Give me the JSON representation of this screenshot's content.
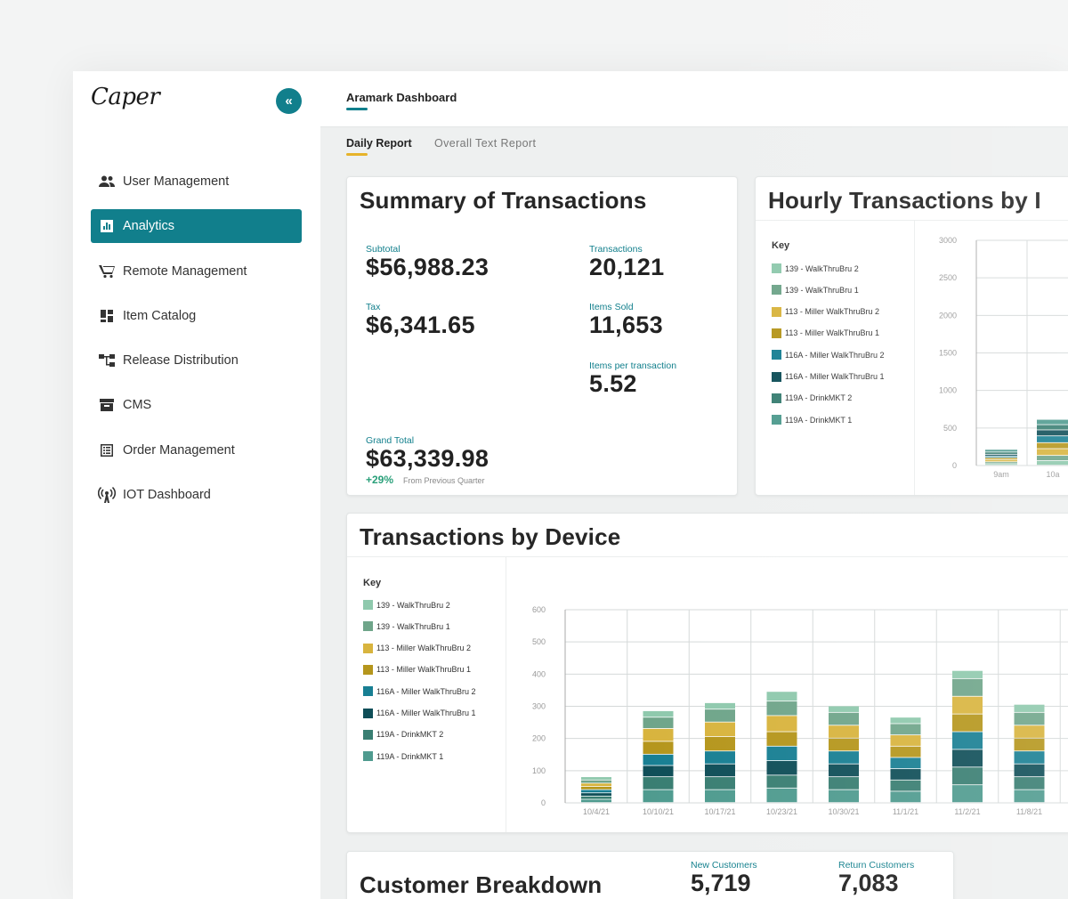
{
  "app": {
    "logo": "Caper",
    "collapse_icon": "«",
    "accent": "#117f8c"
  },
  "sidebar": {
    "items": [
      {
        "label": "User Management",
        "icon": "users-icon"
      },
      {
        "label": "Analytics",
        "icon": "bar-chart-icon",
        "active": true
      },
      {
        "label": "Remote Management",
        "icon": "cart-icon"
      },
      {
        "label": "Item Catalog",
        "icon": "grid-icon"
      },
      {
        "label": "Release Distribution",
        "icon": "tree-icon"
      },
      {
        "label": "CMS",
        "icon": "archive-icon"
      },
      {
        "label": "Order Management",
        "icon": "list-icon"
      },
      {
        "label": "IOT Dashboard",
        "icon": "broadcast-icon"
      }
    ]
  },
  "header": {
    "title": "Aramark Dashboard"
  },
  "tabs": [
    {
      "label": "Daily Report",
      "active": true
    },
    {
      "label": "Overall Text Report"
    }
  ],
  "summary": {
    "title": "Summary of Transactions",
    "subtotal_label": "Subtotal",
    "subtotal": "$56,988.23",
    "tax_label": "Tax",
    "tax": "$6,341.65",
    "transactions_label": "Transactions",
    "transactions": "20,121",
    "items_sold_label": "Items Sold",
    "items_sold": "11,653",
    "ipt_label": "Items per transaction",
    "ipt": "5.52",
    "grand_total_label": "Grand Total",
    "grand_total": "$63,339.98",
    "change": "+29%",
    "change_note": "From Previous Quarter"
  },
  "hourly": {
    "title": "Hourly Transactions by I",
    "key_title": "Key"
  },
  "device": {
    "title": "Transactions by Device",
    "key_title": "Key"
  },
  "legend": [
    {
      "label": "139 -  WalkThruBru 2",
      "color": "#8fc9ad"
    },
    {
      "label": "139 -  WalkThruBru 1",
      "color": "#6fa58a"
    },
    {
      "label": "113 - Miller WalkThruBru 2",
      "color": "#d8b43e"
    },
    {
      "label": "113 - Miller WalkThruBru 1",
      "color": "#b5961c"
    },
    {
      "label": "116A - Miller WalkThruBru 2",
      "color": "#187f93"
    },
    {
      "label": "116A - Miller WalkThruBru 1",
      "color": "#0f4e58"
    },
    {
      "label": "119A - DrinkMKT 2",
      "color": "#397e72"
    },
    {
      "label": "119A - DrinkMKT 1",
      "color": "#4f9b8f"
    }
  ],
  "customers": {
    "title": "Customer Breakdown",
    "new_label": "New Customers",
    "new_value": "5,719",
    "return_label": "Return Customers",
    "return_value": "7,083"
  },
  "chart_data": [
    {
      "type": "bar",
      "title": "Hourly Transactions by I",
      "stacked": true,
      "ylim": [
        0,
        3000
      ],
      "yticks": [
        "3000",
        "2500",
        "2000",
        "1500",
        "1000",
        "500",
        "0"
      ],
      "categories": [
        "9am",
        "10a"
      ],
      "series": [
        {
          "name": "139 -  WalkThruBru 2",
          "values": [
            20,
            60
          ]
        },
        {
          "name": "139 -  WalkThruBru 1",
          "values": [
            25,
            70
          ]
        },
        {
          "name": "113 - Miller WalkThruBru 2",
          "values": [
            30,
            90
          ]
        },
        {
          "name": "113 - Miller WalkThruBru 1",
          "values": [
            25,
            80
          ]
        },
        {
          "name": "116A - Miller WalkThruBru 2",
          "values": [
            20,
            90
          ]
        },
        {
          "name": "116A - Miller WalkThruBru 1",
          "values": [
            25,
            80
          ]
        },
        {
          "name": "119A - DrinkMKT 2",
          "values": [
            30,
            70
          ]
        },
        {
          "name": "119A - DrinkMKT 1",
          "values": [
            35,
            70
          ]
        }
      ]
    },
    {
      "type": "bar",
      "title": "Transactions by Device",
      "stacked": true,
      "ylim": [
        0,
        600
      ],
      "yticks": [
        "600",
        "500",
        "400",
        "300",
        "200",
        "100",
        "0"
      ],
      "categories": [
        "10/4/21",
        "10/10/21",
        "10/17/21",
        "10/23/21",
        "10/30/21",
        "11/1/21",
        "11/2/21",
        "11/8/21"
      ],
      "series": [
        {
          "name": "119A - DrinkMKT 1",
          "values": [
            10,
            40,
            40,
            45,
            40,
            35,
            55,
            40
          ]
        },
        {
          "name": "119A - DrinkMKT 2",
          "values": [
            10,
            40,
            40,
            40,
            40,
            35,
            55,
            40
          ]
        },
        {
          "name": "116A - Miller WalkThruBru 1",
          "values": [
            10,
            35,
            40,
            45,
            40,
            35,
            55,
            40
          ]
        },
        {
          "name": "116A - Miller WalkThruBru 2",
          "values": [
            10,
            35,
            40,
            45,
            40,
            35,
            55,
            40
          ]
        },
        {
          "name": "113 - Miller WalkThruBru 1",
          "values": [
            10,
            40,
            45,
            45,
            40,
            35,
            55,
            40
          ]
        },
        {
          "name": "113 - Miller WalkThruBru 2",
          "values": [
            10,
            40,
            45,
            50,
            40,
            35,
            55,
            40
          ]
        },
        {
          "name": "139 -  WalkThruBru 1",
          "values": [
            10,
            35,
            40,
            45,
            40,
            35,
            55,
            40
          ]
        },
        {
          "name": "139 -  WalkThruBru 2",
          "values": [
            10,
            20,
            20,
            30,
            20,
            20,
            25,
            25
          ]
        }
      ]
    }
  ]
}
